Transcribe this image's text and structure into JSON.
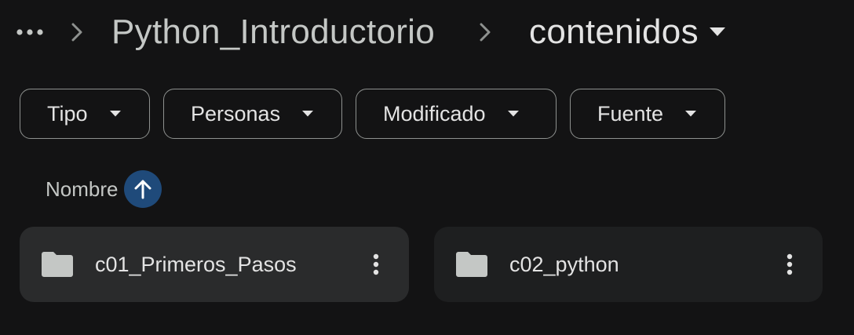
{
  "breadcrumb": {
    "more_icon": "more-horiz-icon",
    "parent": "Python_Introductorio",
    "current": "contenidos"
  },
  "filters": [
    {
      "label": "Tipo"
    },
    {
      "label": "Personas"
    },
    {
      "label": "Modificado"
    },
    {
      "label": "Fuente"
    }
  ],
  "sort": {
    "label": "Nombre",
    "direction_icon": "arrow-upward-icon"
  },
  "folders": [
    {
      "name": "c01_Primeros_Pasos",
      "icon": "folder-icon"
    },
    {
      "name": "c02_python",
      "icon": "folder-icon"
    }
  ],
  "colors": {
    "background": "#131314",
    "card_selected": "#2a2b2c",
    "card": "#1e1f20",
    "sort_button": "#1f4a7a",
    "text": "#e3e3e3",
    "muted_text": "#c4c7c5"
  }
}
